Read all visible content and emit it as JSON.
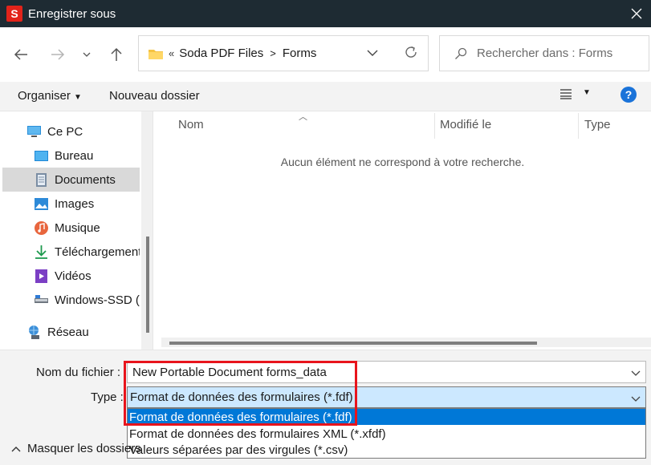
{
  "window": {
    "title": "Enregistrer sous",
    "logo_letter": "S"
  },
  "address": {
    "breadcrumb_prefix": "«",
    "crumbs": [
      "Soda PDF Files",
      "Forms"
    ],
    "separator": ">"
  },
  "search": {
    "placeholder": "Rechercher dans : Forms"
  },
  "toolbar": {
    "organize_label": "Organiser",
    "new_folder_label": "Nouveau dossier",
    "help_label": "?"
  },
  "sidebar": {
    "items": [
      {
        "label": "Ce PC",
        "icon": "pc-icon"
      },
      {
        "label": "Bureau",
        "icon": "desktop-icon"
      },
      {
        "label": "Documents",
        "icon": "documents-icon"
      },
      {
        "label": "Images",
        "icon": "images-icon"
      },
      {
        "label": "Musique",
        "icon": "music-icon"
      },
      {
        "label": "Téléchargements",
        "icon": "downloads-icon"
      },
      {
        "label": "Vidéos",
        "icon": "videos-icon"
      },
      {
        "label": "Windows-SSD (C:)",
        "icon": "drive-icon"
      },
      {
        "label": "Réseau",
        "icon": "network-icon"
      }
    ]
  },
  "list": {
    "columns": [
      "Nom",
      "Modifié le",
      "Type"
    ],
    "empty_message": "Aucun élément ne correspond à votre recherche."
  },
  "form": {
    "filename_label": "Nom du fichier :",
    "filename_value": "New Portable Document forms_data",
    "type_label": "Type :",
    "type_value": "Format de données des formulaires (*.fdf)",
    "type_options": [
      "Format de données des formulaires (*.fdf)",
      "Format de données des formulaires XML (*.xfdf)",
      "Valeurs séparées par des virgules (*.csv)"
    ],
    "hide_folders_label": "Masquer les dossiers"
  },
  "colors": {
    "titlebar": "#1e2b33",
    "accent": "#0078d7",
    "highlight_box": "#e8141c",
    "logo": "#e2231a"
  }
}
